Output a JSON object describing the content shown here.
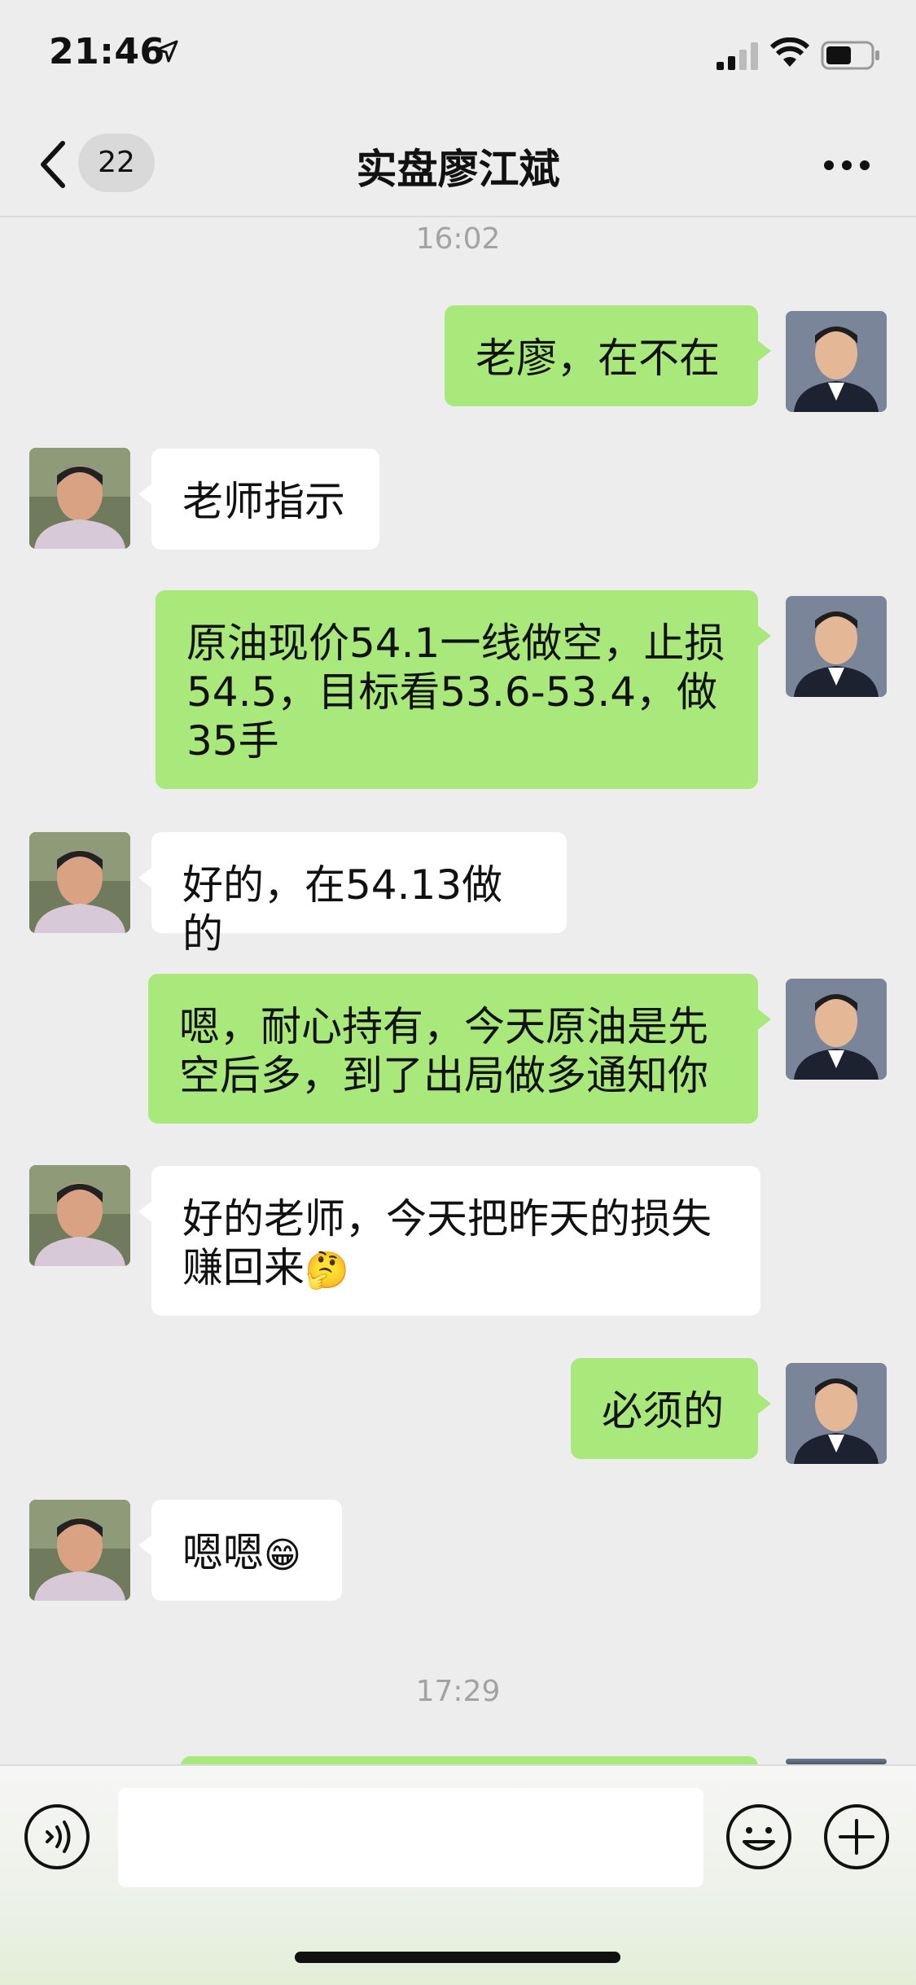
{
  "status_bar": {
    "time": "21:46"
  },
  "nav": {
    "unread_count": "22",
    "title": "实盘廖江斌"
  },
  "timestamps": [
    "16:02",
    "17:29"
  ],
  "messages": [
    {
      "side": "right",
      "text": "老廖，在不在"
    },
    {
      "side": "left",
      "text": "老师指示"
    },
    {
      "side": "right",
      "text": "原油现价54.1一线做空，止损54.5，目标看53.6-53.4，做35手"
    },
    {
      "side": "left",
      "text": "好的，在54.13做的"
    },
    {
      "side": "right",
      "text": "嗯，耐心持有，今天原油是先空后多，到了出局做多通知你"
    },
    {
      "side": "left",
      "text": "好的老师，今天把昨天的损失赚回来",
      "emoji": "🤔"
    },
    {
      "side": "right",
      "text": "必须的"
    },
    {
      "side": "left",
      "text": "嗯嗯",
      "emoji": "😁"
    }
  ],
  "input": {
    "value": ""
  }
}
